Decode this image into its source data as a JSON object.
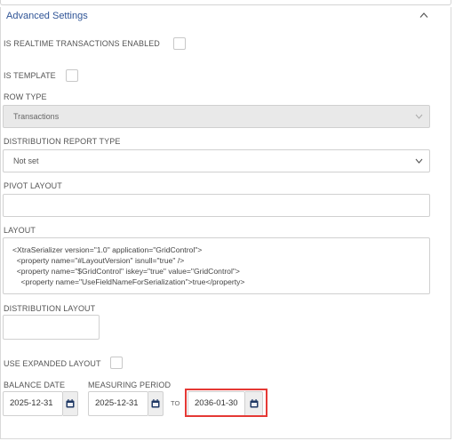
{
  "section": {
    "title": "Advanced Settings"
  },
  "fields": {
    "realtime_label": "IS REALTIME TRANSACTIONS ENABLED",
    "template_label": "IS TEMPLATE",
    "row_type_label": "ROW TYPE",
    "row_type_value": "Transactions",
    "dist_report_label": "DISTRIBUTION REPORT TYPE",
    "dist_report_value": "Not set",
    "pivot_label": "PIVOT LAYOUT",
    "pivot_value": "",
    "layout_label": "LAYOUT",
    "layout_value": "<XtraSerializer version=\"1.0\" application=\"GridControl\">\n  <property name=\"#LayoutVersion\" isnull=\"true\" />\n  <property name=\"$GridControl\" iskey=\"true\" value=\"GridControl\">\n    <property name=\"UseFieldNameForSerialization\">true</property>",
    "dist_layout_label": "DISTRIBUTION LAYOUT",
    "expanded_label": "USE EXPANDED LAYOUT",
    "balance_date_label": "BALANCE DATE",
    "balance_date_value": "2025-12-31",
    "measuring_label": "MEASURING PERIOD",
    "measuring_from": "2025-12-31",
    "to_label": "TO",
    "measuring_to": "2036-01-30"
  },
  "checkboxes": {
    "realtime": false,
    "template": false,
    "expanded": false
  },
  "colors": {
    "accent": "#2f5496",
    "calendar_icon": "#1f3864",
    "highlight": "#e53935"
  },
  "icons": {
    "collapse": "chevron-up-icon",
    "dropdown": "chevron-down-icon",
    "date": "calendar-icon"
  }
}
